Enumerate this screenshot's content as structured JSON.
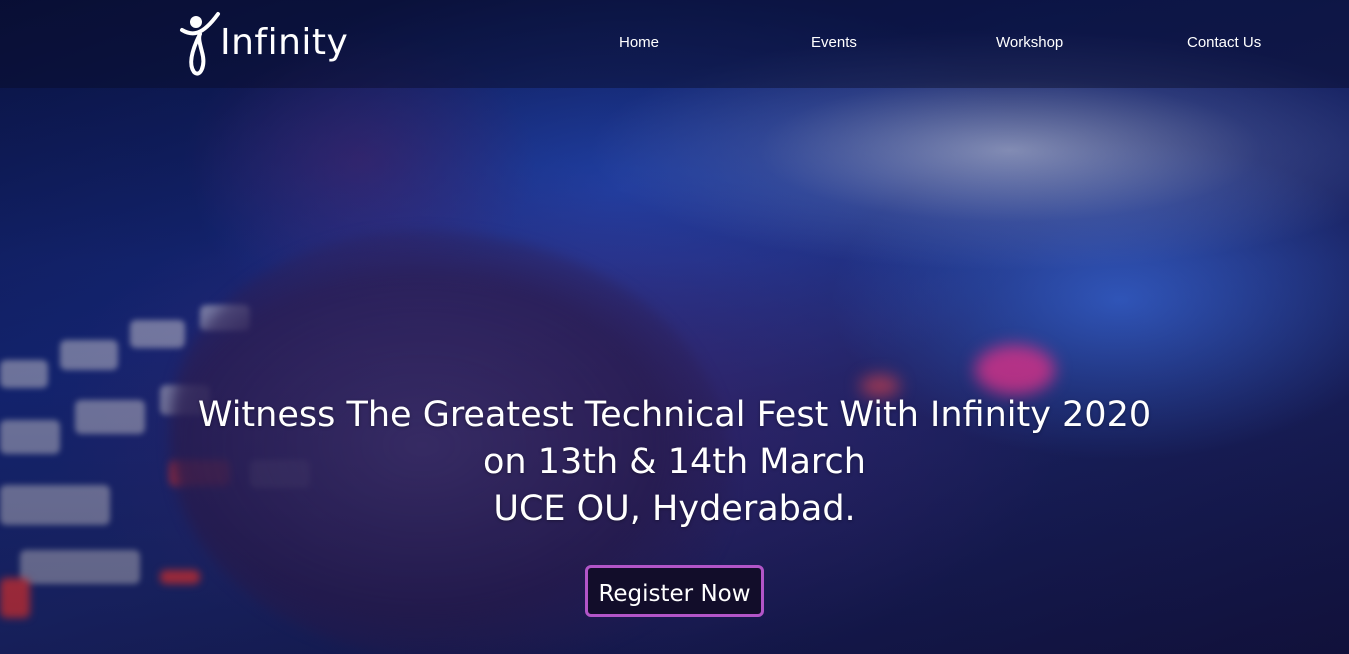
{
  "brand": {
    "name": "Infinity",
    "icon": "infinity-figure-logo-icon"
  },
  "nav": {
    "items": [
      {
        "label": "Home"
      },
      {
        "label": "Events"
      },
      {
        "label": "Workshop"
      },
      {
        "label": "Contact Us"
      }
    ]
  },
  "hero": {
    "line1": "Witness The Greatest Technical Fest With Infinity 2020",
    "line2": "on 13th & 14th March",
    "line3": "UCE OU, Hyderabad.",
    "cta_label": "Register Now"
  },
  "colors": {
    "cta_border": "#b255c8",
    "cta_background": "#120d2a",
    "text": "#ffffff"
  }
}
